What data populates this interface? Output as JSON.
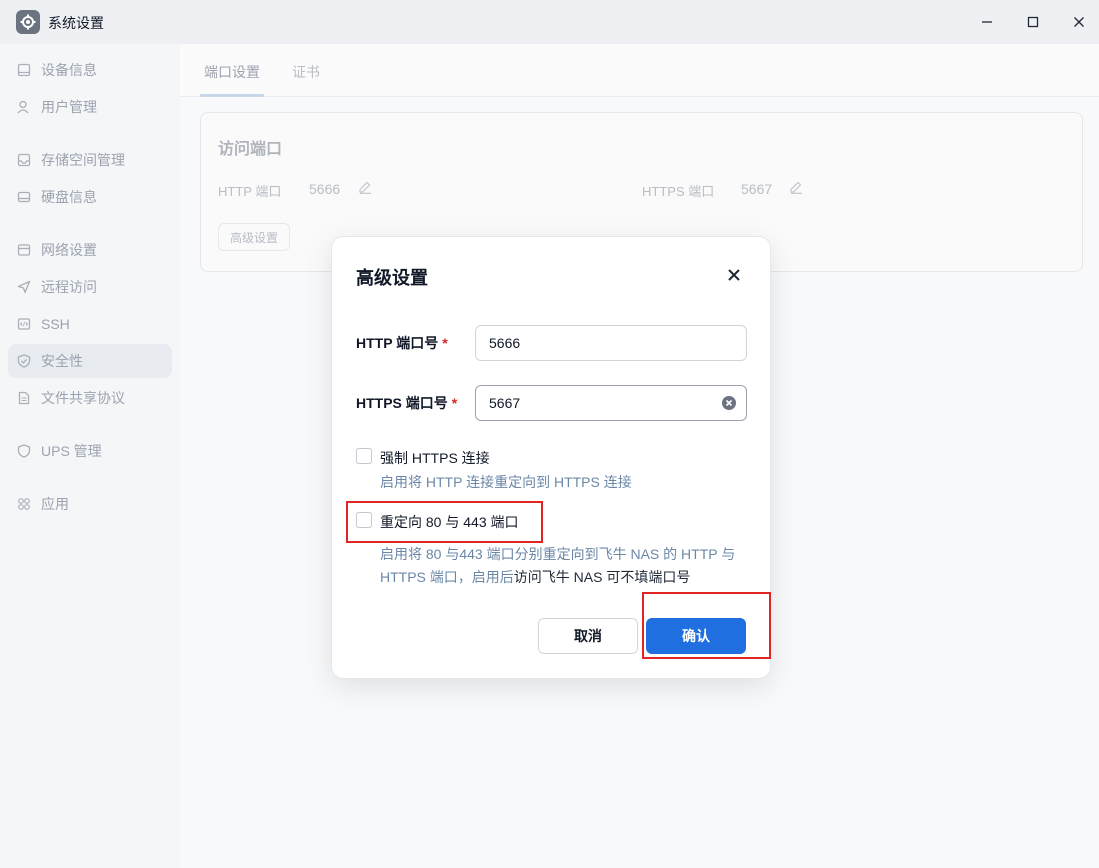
{
  "window": {
    "title": "系统设置",
    "app_icon": "gear-icon",
    "controls": [
      "minimize-icon",
      "maximize-icon",
      "close-icon"
    ]
  },
  "sidebar": {
    "items": [
      {
        "label": "设备信息",
        "icon": "device-icon"
      },
      {
        "label": "用户管理",
        "icon": "user-icon"
      },
      {
        "label": "存储空间管理",
        "icon": "storage-icon"
      },
      {
        "label": "硬盘信息",
        "icon": "disk-icon"
      },
      {
        "label": "网络设置",
        "icon": "network-icon"
      },
      {
        "label": "远程访问",
        "icon": "send-icon"
      },
      {
        "label": "SSH",
        "icon": "code-icon"
      },
      {
        "label": "安全性",
        "icon": "shield-check-icon",
        "active": true
      },
      {
        "label": "文件共享协议",
        "icon": "file-icon"
      },
      {
        "label": "UPS 管理",
        "icon": "shield-icon"
      },
      {
        "label": "应用",
        "icon": "apps-icon"
      }
    ]
  },
  "tabs": [
    {
      "label": "端口设置",
      "active": true
    },
    {
      "label": "证书",
      "active": false
    }
  ],
  "card": {
    "title": "访问端口",
    "http_label": "HTTP 端口",
    "http_value": "5666",
    "https_label": "HTTPS 端口",
    "https_value": "5667",
    "advanced_button": "高级设置"
  },
  "dialog": {
    "title": "高级设置",
    "http_port_label": "HTTP 端口号",
    "http_port_value": "5666",
    "https_port_label": "HTTPS 端口号",
    "https_port_value": "5667",
    "required_mark": "*",
    "force_https_label": "强制 HTTPS 连接",
    "force_https_desc": "启用将 HTTP 连接重定向到 HTTPS 连接",
    "redirect_label": "重定向 80 与 443 端口",
    "redirect_desc_a": "启用将 80 与443 端口分别重定向到飞牛 NAS 的 HTTP 与 HTTPS 端口，启用后",
    "redirect_desc_b": "访问飞牛 NAS 可不填端口号",
    "cancel": "取消",
    "confirm": "确认"
  },
  "colors": {
    "primary": "#1f6fe0",
    "required": "#dc2626",
    "highlight": "#e02424",
    "desc_text": "#6b87a8"
  }
}
